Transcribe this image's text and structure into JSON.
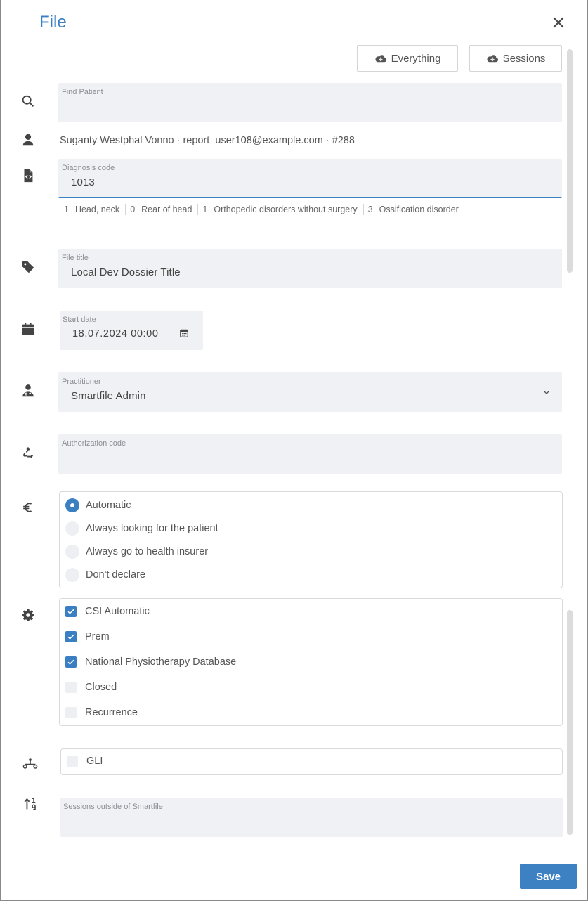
{
  "dialog": {
    "title": "File"
  },
  "toolbar": {
    "everything_label": "Everything",
    "sessions_label": "Sessions"
  },
  "find_patient": {
    "label": "Find Patient",
    "value": ""
  },
  "patient": {
    "info": "Suganty Westphal Vonno · report_user108@example.com · #288"
  },
  "diagnosis": {
    "label": "Diagnosis code",
    "value": "1013",
    "tags": [
      {
        "code": "1",
        "text": "Head, neck"
      },
      {
        "code": "0",
        "text": "Rear of head"
      },
      {
        "code": "1",
        "text": "Orthopedic disorders without surgery"
      },
      {
        "code": "3",
        "text": "Ossification disorder"
      }
    ]
  },
  "file_title": {
    "label": "File title",
    "value": "Local Dev Dossier Title"
  },
  "start_date": {
    "label": "Start date",
    "value": "18.07.2024 00:00"
  },
  "practitioner": {
    "label": "Practitioner",
    "value": "Smartfile Admin"
  },
  "authorization": {
    "label": "Authorization code",
    "value": ""
  },
  "billing": {
    "options": [
      {
        "label": "Automatic",
        "selected": true
      },
      {
        "label": "Always looking for the patient",
        "selected": false
      },
      {
        "label": "Always go to health insurer",
        "selected": false
      },
      {
        "label": "Don't declare",
        "selected": false
      }
    ]
  },
  "settings": {
    "options": [
      {
        "label": "CSI Automatic",
        "checked": true
      },
      {
        "label": "Prem",
        "checked": true
      },
      {
        "label": "National Physiotherapy Database",
        "checked": true
      },
      {
        "label": "Closed",
        "checked": false
      },
      {
        "label": "Recurrence",
        "checked": false
      }
    ]
  },
  "gli": {
    "label": "GLI",
    "checked": false
  },
  "sessions_outside": {
    "label": "Sessions outside of Smartfile",
    "value": ""
  },
  "footer": {
    "save_label": "Save"
  },
  "colors": {
    "accent": "#3a7fc1",
    "field_bg": "#f0f1f4"
  }
}
